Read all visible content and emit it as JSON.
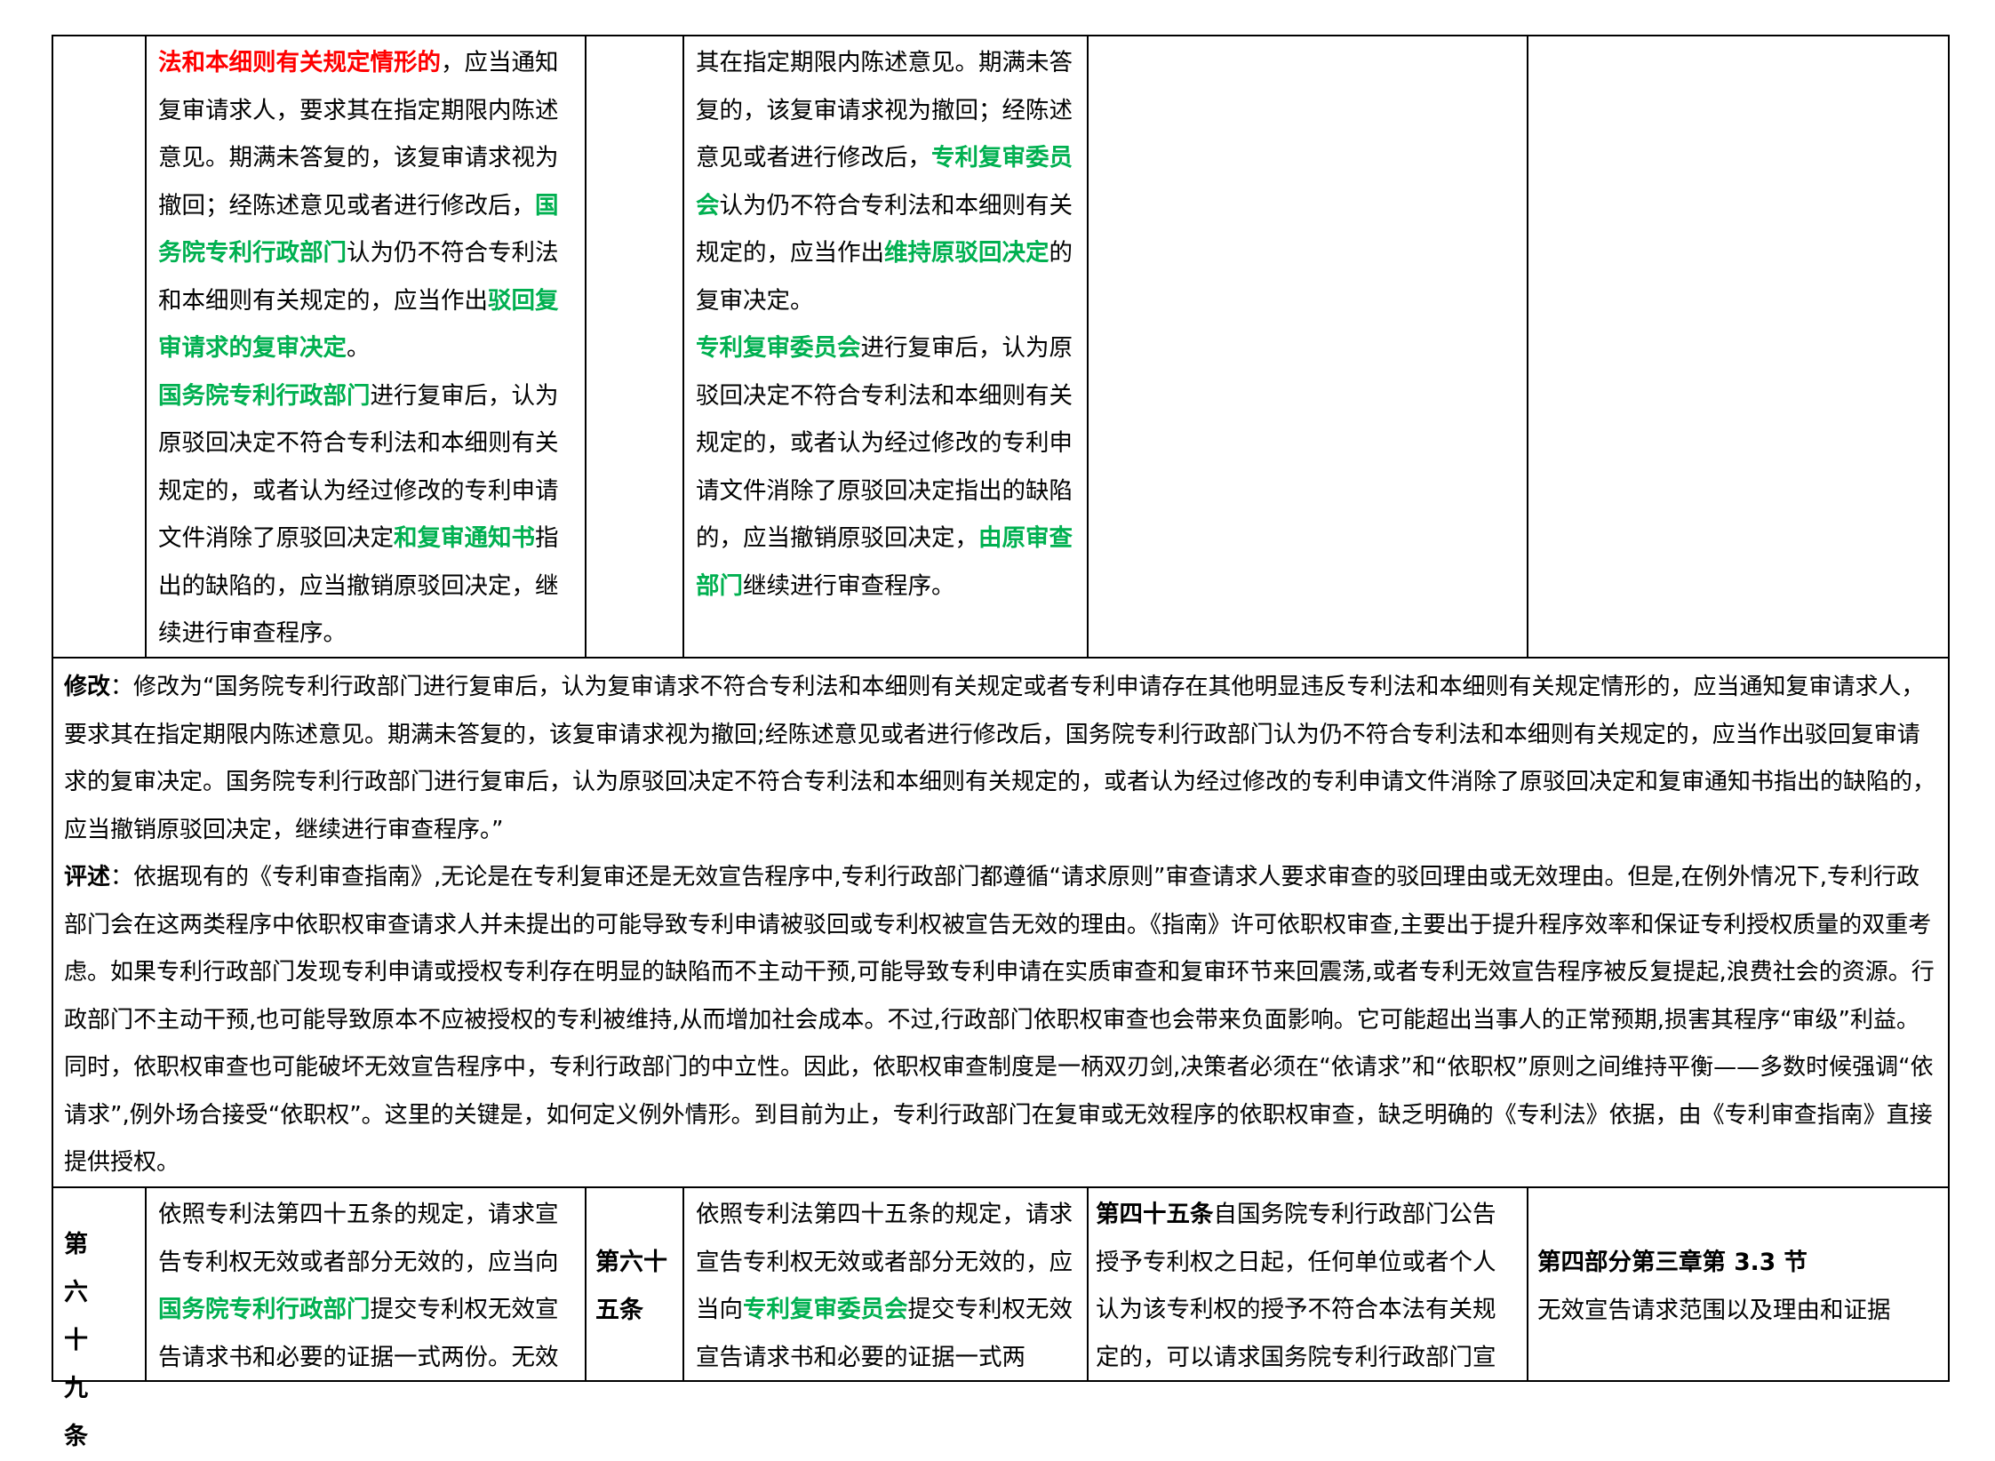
{
  "colors": {
    "red": "#ff0000",
    "green": "#00b050",
    "border": "#000000"
  },
  "top_row": {
    "col2": [
      {
        "t": "法和本细则有关规定情形的",
        "s": "red"
      },
      {
        "t": "，应当通知复审请求人，要求其在指定期限内陈述意见。期满未答复的，该复审请求视为撤回；经陈述意见或者进行修改后，",
        "s": ""
      },
      {
        "t": "国务院专利行政部门",
        "s": "green"
      },
      {
        "t": "认为仍不符合专利法和本细则有关规定的，应当作出",
        "s": ""
      },
      {
        "t": "驳回复审请求的复审决定",
        "s": "green"
      },
      {
        "t": "。",
        "s": ""
      },
      {
        "t": "国务院专利行政部门",
        "s": "green"
      },
      {
        "t": "进行复审后，认为原驳回决定不符合专利法和本细则有关规定的，或者认为经过修改的专利申请文件消除了原驳回决定",
        "s": ""
      },
      {
        "t": "和复审通知书",
        "s": "green"
      },
      {
        "t": "指出的缺陷的，应当撤销原驳回决定，继续进行审查程序。",
        "s": ""
      }
    ],
    "col4": [
      {
        "t": "其在指定期限内陈述意见。期满未答复的，该复审请求视为撤回；经陈述意见或者进行修改后，",
        "s": ""
      },
      {
        "t": "专利复审委员会",
        "s": "green"
      },
      {
        "t": "认为仍不符合专利法和本细则有关规定的，应当作出",
        "s": ""
      },
      {
        "t": "维持原驳回决定",
        "s": "green"
      },
      {
        "t": "的复审决定。",
        "s": ""
      },
      {
        "t": "专利复审委员会",
        "s": "green"
      },
      {
        "t": "进行复审后，认为原驳回决定不符合专利法和本细则有关规定的，或者认为经过修改的专利申请文件消除了原驳回决定指出的缺陷的，应当撤销原驳回决定，",
        "s": ""
      },
      {
        "t": "由原审查部门",
        "s": "green"
      },
      {
        "t": "继续进行审查程序。",
        "s": ""
      }
    ]
  },
  "middle": {
    "modify_label": "修改",
    "modify_text": "：修改为“国务院专利行政部门进行复审后，认为复审请求不符合专利法和本细则有关规定或者专利申请存在其他明显违反专利法和本细则有关规定情形的，应当通知复审请求人，要求其在指定期限内陈述意见。期满未答复的，该复审请求视为撤回;经陈述意见或者进行修改后，国务院专利行政部门认为仍不符合专利法和本细则有关规定的，应当作出驳回复审请求的复审决定。国务院专利行政部门进行复审后，认为原驳回决定不符合专利法和本细则有关规定的，或者认为经过修改的专利申请文件消除了原驳回决定和复审通知书指出的缺陷的，应当撤销原驳回决定，继续进行审查程序。”",
    "comment_label": "评述",
    "comment_text": "：依据现有的《专利审查指南》,无论是在专利复审还是无效宣告程序中,专利行政部门都遵循“请求原则”审查请求人要求审查的驳回理由或无效理由。但是,在例外情况下,专利行政部门会在这两类程序中依职权审查请求人并未提出的可能导致专利申请被驳回或专利权被宣告无效的理由。《指南》许可依职权审查,主要出于提升程序效率和保证专利授权质量的双重考虑。如果专利行政部门发现专利申请或授权专利存在明显的缺陷而不主动干预,可能导致专利申请在实质审查和复审环节来回震荡,或者专利无效宣告程序被反复提起,浪费社会的资源。行政部门不主动干预,也可能导致原本不应被授权的专利被维持,从而增加社会成本。不过,行政部门依职权审查也会带来负面影响。它可能超出当事人的正常预期,损害其程序“审级”利益。同时，依职权审查也可能破坏无效宣告程序中，专利行政部门的中立性。因此，依职权审查制度是一柄双刃剑,决策者必须在“依请求”和“依职权”原则之间维持平衡——多数时候强调“依请求”,例外场合接受“依职权”。这里的关键是，如何定义例外情形。到目前为止，专利行政部门在复审或无效程序的依职权审查，缺乏明确的《专利法》依据，由《专利审查指南》直接提供授权。"
  },
  "bottom_row": {
    "col1": "第六十九条",
    "col2": [
      {
        "t": "依照专利法第四十五条的规定，请求宣告专利权无效或者部分无效的，应当向",
        "s": ""
      },
      {
        "t": "国务院专利行政部门",
        "s": "green"
      },
      {
        "t": "提交专利权无效宣告请求书和必要的证据一式两份。无效",
        "s": ""
      }
    ],
    "col3": "第六十五条",
    "col4": [
      {
        "t": "依照专利法第四十五条的规定，请求宣告专利权无效或者部分无效的，应当向",
        "s": ""
      },
      {
        "t": "专利复审委员会",
        "s": "green"
      },
      {
        "t": "提交专利权无效宣告请求书和必要的证据一式两",
        "s": ""
      }
    ],
    "col5": [
      {
        "t": "第四十五条",
        "s": "b"
      },
      {
        "t": "自国务院专利行政部门公告授予专利权之日起，任何单位或者个人认为该专利权的授予不符合本法有关规定的，可以请求国务院专利行政部门宣",
        "s": ""
      }
    ],
    "col6_title": "第四部分第三章第 3.3 节",
    "col6_text": "无效宣告请求范围以及理由和证据"
  }
}
